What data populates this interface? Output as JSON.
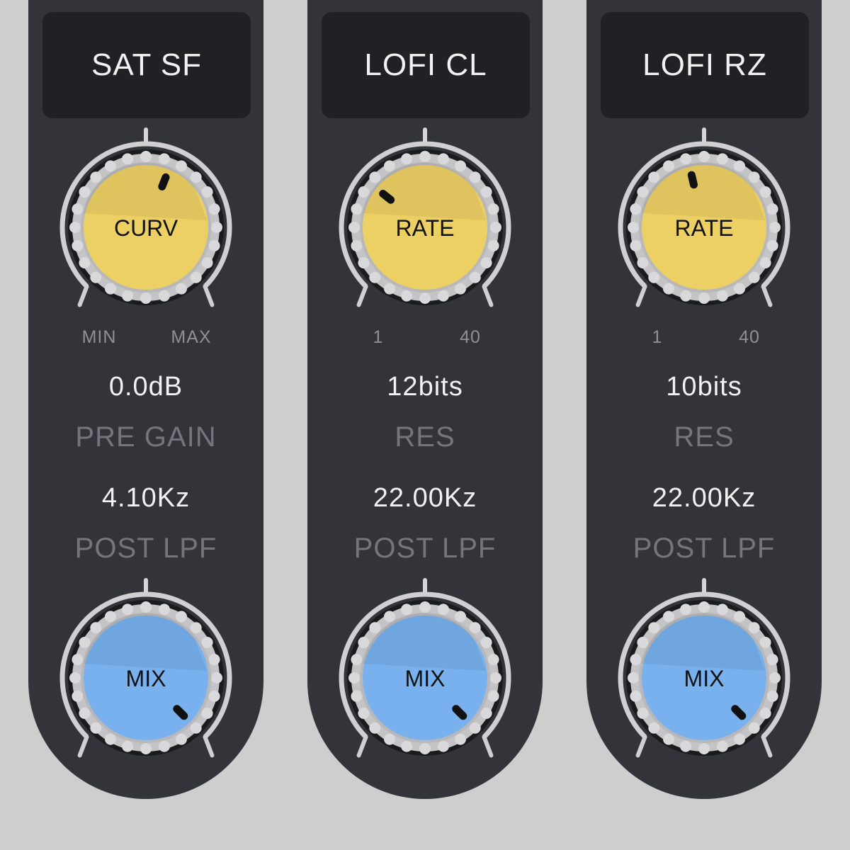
{
  "colors": {
    "background": "#cfcecf",
    "strip": "#323439",
    "title_box": "#202124",
    "knob_yellow": "#ecd064",
    "knob_blue": "#78b1ee",
    "value_text": "#f2f2f2",
    "param_text": "#73767c"
  },
  "modules": [
    {
      "title": "SAT SF",
      "top_knob": {
        "label": "CURV",
        "min_label": "MIN",
        "max_label": "MAX",
        "position": 0.58
      },
      "param1": {
        "value": "0.0dB",
        "name": "PRE GAIN"
      },
      "param2": {
        "value": "4.10Kz",
        "name": "POST LPF"
      },
      "mix_knob": {
        "label": "MIX",
        "position": 1.0
      }
    },
    {
      "title": "LOFI CL",
      "top_knob": {
        "label": "RATE",
        "min_label": "1",
        "max_label": "40",
        "position": 0.31
      },
      "param1": {
        "value": "12bits",
        "name": "RES"
      },
      "param2": {
        "value": "22.00Kz",
        "name": "POST LPF"
      },
      "mix_knob": {
        "label": "MIX",
        "position": 1.0
      }
    },
    {
      "title": "LOFI RZ",
      "top_knob": {
        "label": "RATE",
        "min_label": "1",
        "max_label": "40",
        "position": 0.45
      },
      "param1": {
        "value": "10bits",
        "name": "RES"
      },
      "param2": {
        "value": "22.00Kz",
        "name": "POST LPF"
      },
      "mix_knob": {
        "label": "MIX",
        "position": 1.0
      }
    }
  ]
}
